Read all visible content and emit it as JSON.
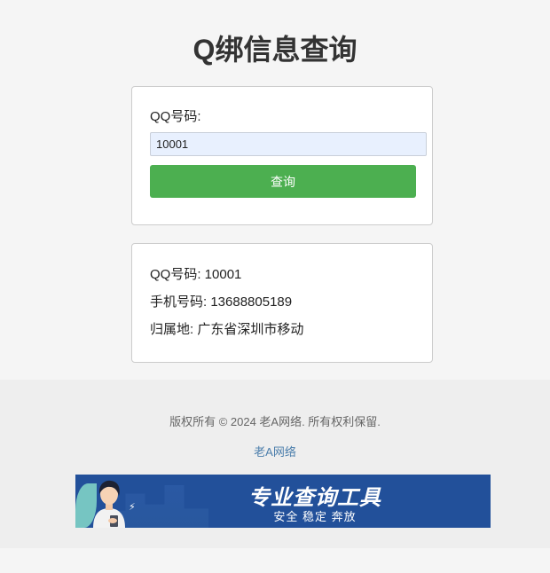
{
  "page": {
    "title": "Q绑信息查询"
  },
  "query_form": {
    "label": "QQ号码:",
    "input_value": "10001",
    "button_label": "查询"
  },
  "result": {
    "qq": "QQ号码: 10001",
    "phone": "手机号码: 13688805189",
    "location": "归属地: 广东省深圳市移动"
  },
  "footer": {
    "copyright": "版权所有 © 2024 老A网络. 所有权利保留.",
    "link_text": "老A网络"
  },
  "banner": {
    "title": "专业查询工具",
    "subtitle": "安全 稳定 奔放"
  },
  "colors": {
    "button": "#4caf50",
    "banner": "#22509a",
    "link": "#4a7dab"
  }
}
